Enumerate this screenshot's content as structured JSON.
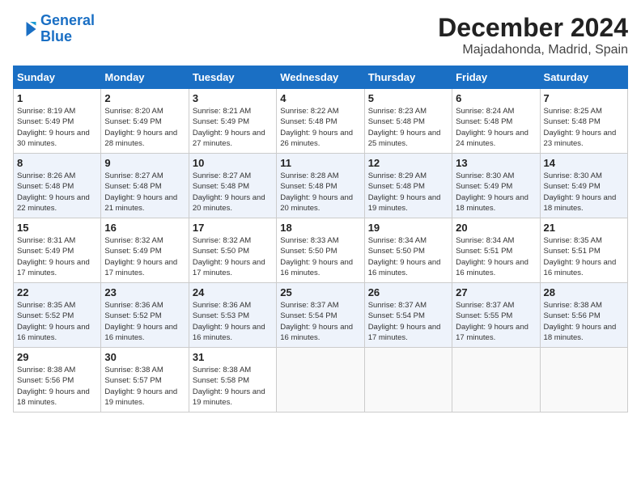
{
  "header": {
    "logo_line1": "General",
    "logo_line2": "Blue",
    "month": "December 2024",
    "location": "Majadahonda, Madrid, Spain"
  },
  "days_of_week": [
    "Sunday",
    "Monday",
    "Tuesday",
    "Wednesday",
    "Thursday",
    "Friday",
    "Saturday"
  ],
  "weeks": [
    [
      {
        "day": "1",
        "sunrise": "Sunrise: 8:19 AM",
        "sunset": "Sunset: 5:49 PM",
        "daylight": "Daylight: 9 hours and 30 minutes."
      },
      {
        "day": "2",
        "sunrise": "Sunrise: 8:20 AM",
        "sunset": "Sunset: 5:49 PM",
        "daylight": "Daylight: 9 hours and 28 minutes."
      },
      {
        "day": "3",
        "sunrise": "Sunrise: 8:21 AM",
        "sunset": "Sunset: 5:49 PM",
        "daylight": "Daylight: 9 hours and 27 minutes."
      },
      {
        "day": "4",
        "sunrise": "Sunrise: 8:22 AM",
        "sunset": "Sunset: 5:48 PM",
        "daylight": "Daylight: 9 hours and 26 minutes."
      },
      {
        "day": "5",
        "sunrise": "Sunrise: 8:23 AM",
        "sunset": "Sunset: 5:48 PM",
        "daylight": "Daylight: 9 hours and 25 minutes."
      },
      {
        "day": "6",
        "sunrise": "Sunrise: 8:24 AM",
        "sunset": "Sunset: 5:48 PM",
        "daylight": "Daylight: 9 hours and 24 minutes."
      },
      {
        "day": "7",
        "sunrise": "Sunrise: 8:25 AM",
        "sunset": "Sunset: 5:48 PM",
        "daylight": "Daylight: 9 hours and 23 minutes."
      }
    ],
    [
      {
        "day": "8",
        "sunrise": "Sunrise: 8:26 AM",
        "sunset": "Sunset: 5:48 PM",
        "daylight": "Daylight: 9 hours and 22 minutes."
      },
      {
        "day": "9",
        "sunrise": "Sunrise: 8:27 AM",
        "sunset": "Sunset: 5:48 PM",
        "daylight": "Daylight: 9 hours and 21 minutes."
      },
      {
        "day": "10",
        "sunrise": "Sunrise: 8:27 AM",
        "sunset": "Sunset: 5:48 PM",
        "daylight": "Daylight: 9 hours and 20 minutes."
      },
      {
        "day": "11",
        "sunrise": "Sunrise: 8:28 AM",
        "sunset": "Sunset: 5:48 PM",
        "daylight": "Daylight: 9 hours and 20 minutes."
      },
      {
        "day": "12",
        "sunrise": "Sunrise: 8:29 AM",
        "sunset": "Sunset: 5:48 PM",
        "daylight": "Daylight: 9 hours and 19 minutes."
      },
      {
        "day": "13",
        "sunrise": "Sunrise: 8:30 AM",
        "sunset": "Sunset: 5:49 PM",
        "daylight": "Daylight: 9 hours and 18 minutes."
      },
      {
        "day": "14",
        "sunrise": "Sunrise: 8:30 AM",
        "sunset": "Sunset: 5:49 PM",
        "daylight": "Daylight: 9 hours and 18 minutes."
      }
    ],
    [
      {
        "day": "15",
        "sunrise": "Sunrise: 8:31 AM",
        "sunset": "Sunset: 5:49 PM",
        "daylight": "Daylight: 9 hours and 17 minutes."
      },
      {
        "day": "16",
        "sunrise": "Sunrise: 8:32 AM",
        "sunset": "Sunset: 5:49 PM",
        "daylight": "Daylight: 9 hours and 17 minutes."
      },
      {
        "day": "17",
        "sunrise": "Sunrise: 8:32 AM",
        "sunset": "Sunset: 5:50 PM",
        "daylight": "Daylight: 9 hours and 17 minutes."
      },
      {
        "day": "18",
        "sunrise": "Sunrise: 8:33 AM",
        "sunset": "Sunset: 5:50 PM",
        "daylight": "Daylight: 9 hours and 16 minutes."
      },
      {
        "day": "19",
        "sunrise": "Sunrise: 8:34 AM",
        "sunset": "Sunset: 5:50 PM",
        "daylight": "Daylight: 9 hours and 16 minutes."
      },
      {
        "day": "20",
        "sunrise": "Sunrise: 8:34 AM",
        "sunset": "Sunset: 5:51 PM",
        "daylight": "Daylight: 9 hours and 16 minutes."
      },
      {
        "day": "21",
        "sunrise": "Sunrise: 8:35 AM",
        "sunset": "Sunset: 5:51 PM",
        "daylight": "Daylight: 9 hours and 16 minutes."
      }
    ],
    [
      {
        "day": "22",
        "sunrise": "Sunrise: 8:35 AM",
        "sunset": "Sunset: 5:52 PM",
        "daylight": "Daylight: 9 hours and 16 minutes."
      },
      {
        "day": "23",
        "sunrise": "Sunrise: 8:36 AM",
        "sunset": "Sunset: 5:52 PM",
        "daylight": "Daylight: 9 hours and 16 minutes."
      },
      {
        "day": "24",
        "sunrise": "Sunrise: 8:36 AM",
        "sunset": "Sunset: 5:53 PM",
        "daylight": "Daylight: 9 hours and 16 minutes."
      },
      {
        "day": "25",
        "sunrise": "Sunrise: 8:37 AM",
        "sunset": "Sunset: 5:54 PM",
        "daylight": "Daylight: 9 hours and 16 minutes."
      },
      {
        "day": "26",
        "sunrise": "Sunrise: 8:37 AM",
        "sunset": "Sunset: 5:54 PM",
        "daylight": "Daylight: 9 hours and 17 minutes."
      },
      {
        "day": "27",
        "sunrise": "Sunrise: 8:37 AM",
        "sunset": "Sunset: 5:55 PM",
        "daylight": "Daylight: 9 hours and 17 minutes."
      },
      {
        "day": "28",
        "sunrise": "Sunrise: 8:38 AM",
        "sunset": "Sunset: 5:56 PM",
        "daylight": "Daylight: 9 hours and 18 minutes."
      }
    ],
    [
      {
        "day": "29",
        "sunrise": "Sunrise: 8:38 AM",
        "sunset": "Sunset: 5:56 PM",
        "daylight": "Daylight: 9 hours and 18 minutes."
      },
      {
        "day": "30",
        "sunrise": "Sunrise: 8:38 AM",
        "sunset": "Sunset: 5:57 PM",
        "daylight": "Daylight: 9 hours and 19 minutes."
      },
      {
        "day": "31",
        "sunrise": "Sunrise: 8:38 AM",
        "sunset": "Sunset: 5:58 PM",
        "daylight": "Daylight: 9 hours and 19 minutes."
      },
      null,
      null,
      null,
      null
    ]
  ]
}
